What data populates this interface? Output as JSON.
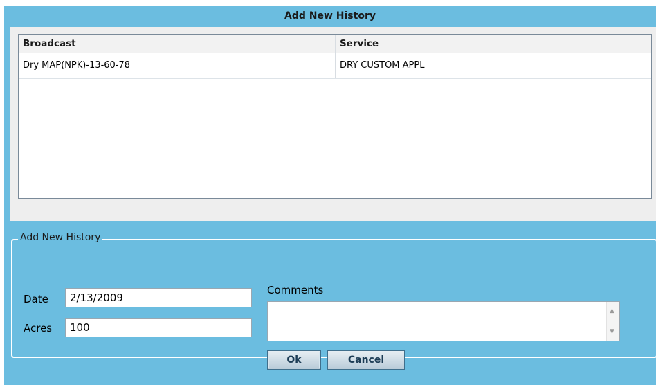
{
  "dialog": {
    "title": "Add New History"
  },
  "grid": {
    "columns": [
      "Broadcast",
      "Service"
    ],
    "rows": [
      [
        "Dry MAP(NPK)-13-60-78",
        "DRY CUSTOM APPL"
      ]
    ]
  },
  "form": {
    "legend": "Add New History",
    "date_label": "Date",
    "date_value": "2/13/2009",
    "acres_label": "Acres",
    "acres_value": "100",
    "comments_label": "Comments",
    "comments_value": "",
    "ok_label": "Ok",
    "cancel_label": "Cancel"
  },
  "icons": {
    "scroll_up": "scroll-up-arrow-icon",
    "scroll_down": "scroll-down-arrow-icon"
  },
  "colors": {
    "panel": "#6bbde0",
    "grid_bg": "#eeeeee",
    "button_border": "#3f6f8c"
  }
}
